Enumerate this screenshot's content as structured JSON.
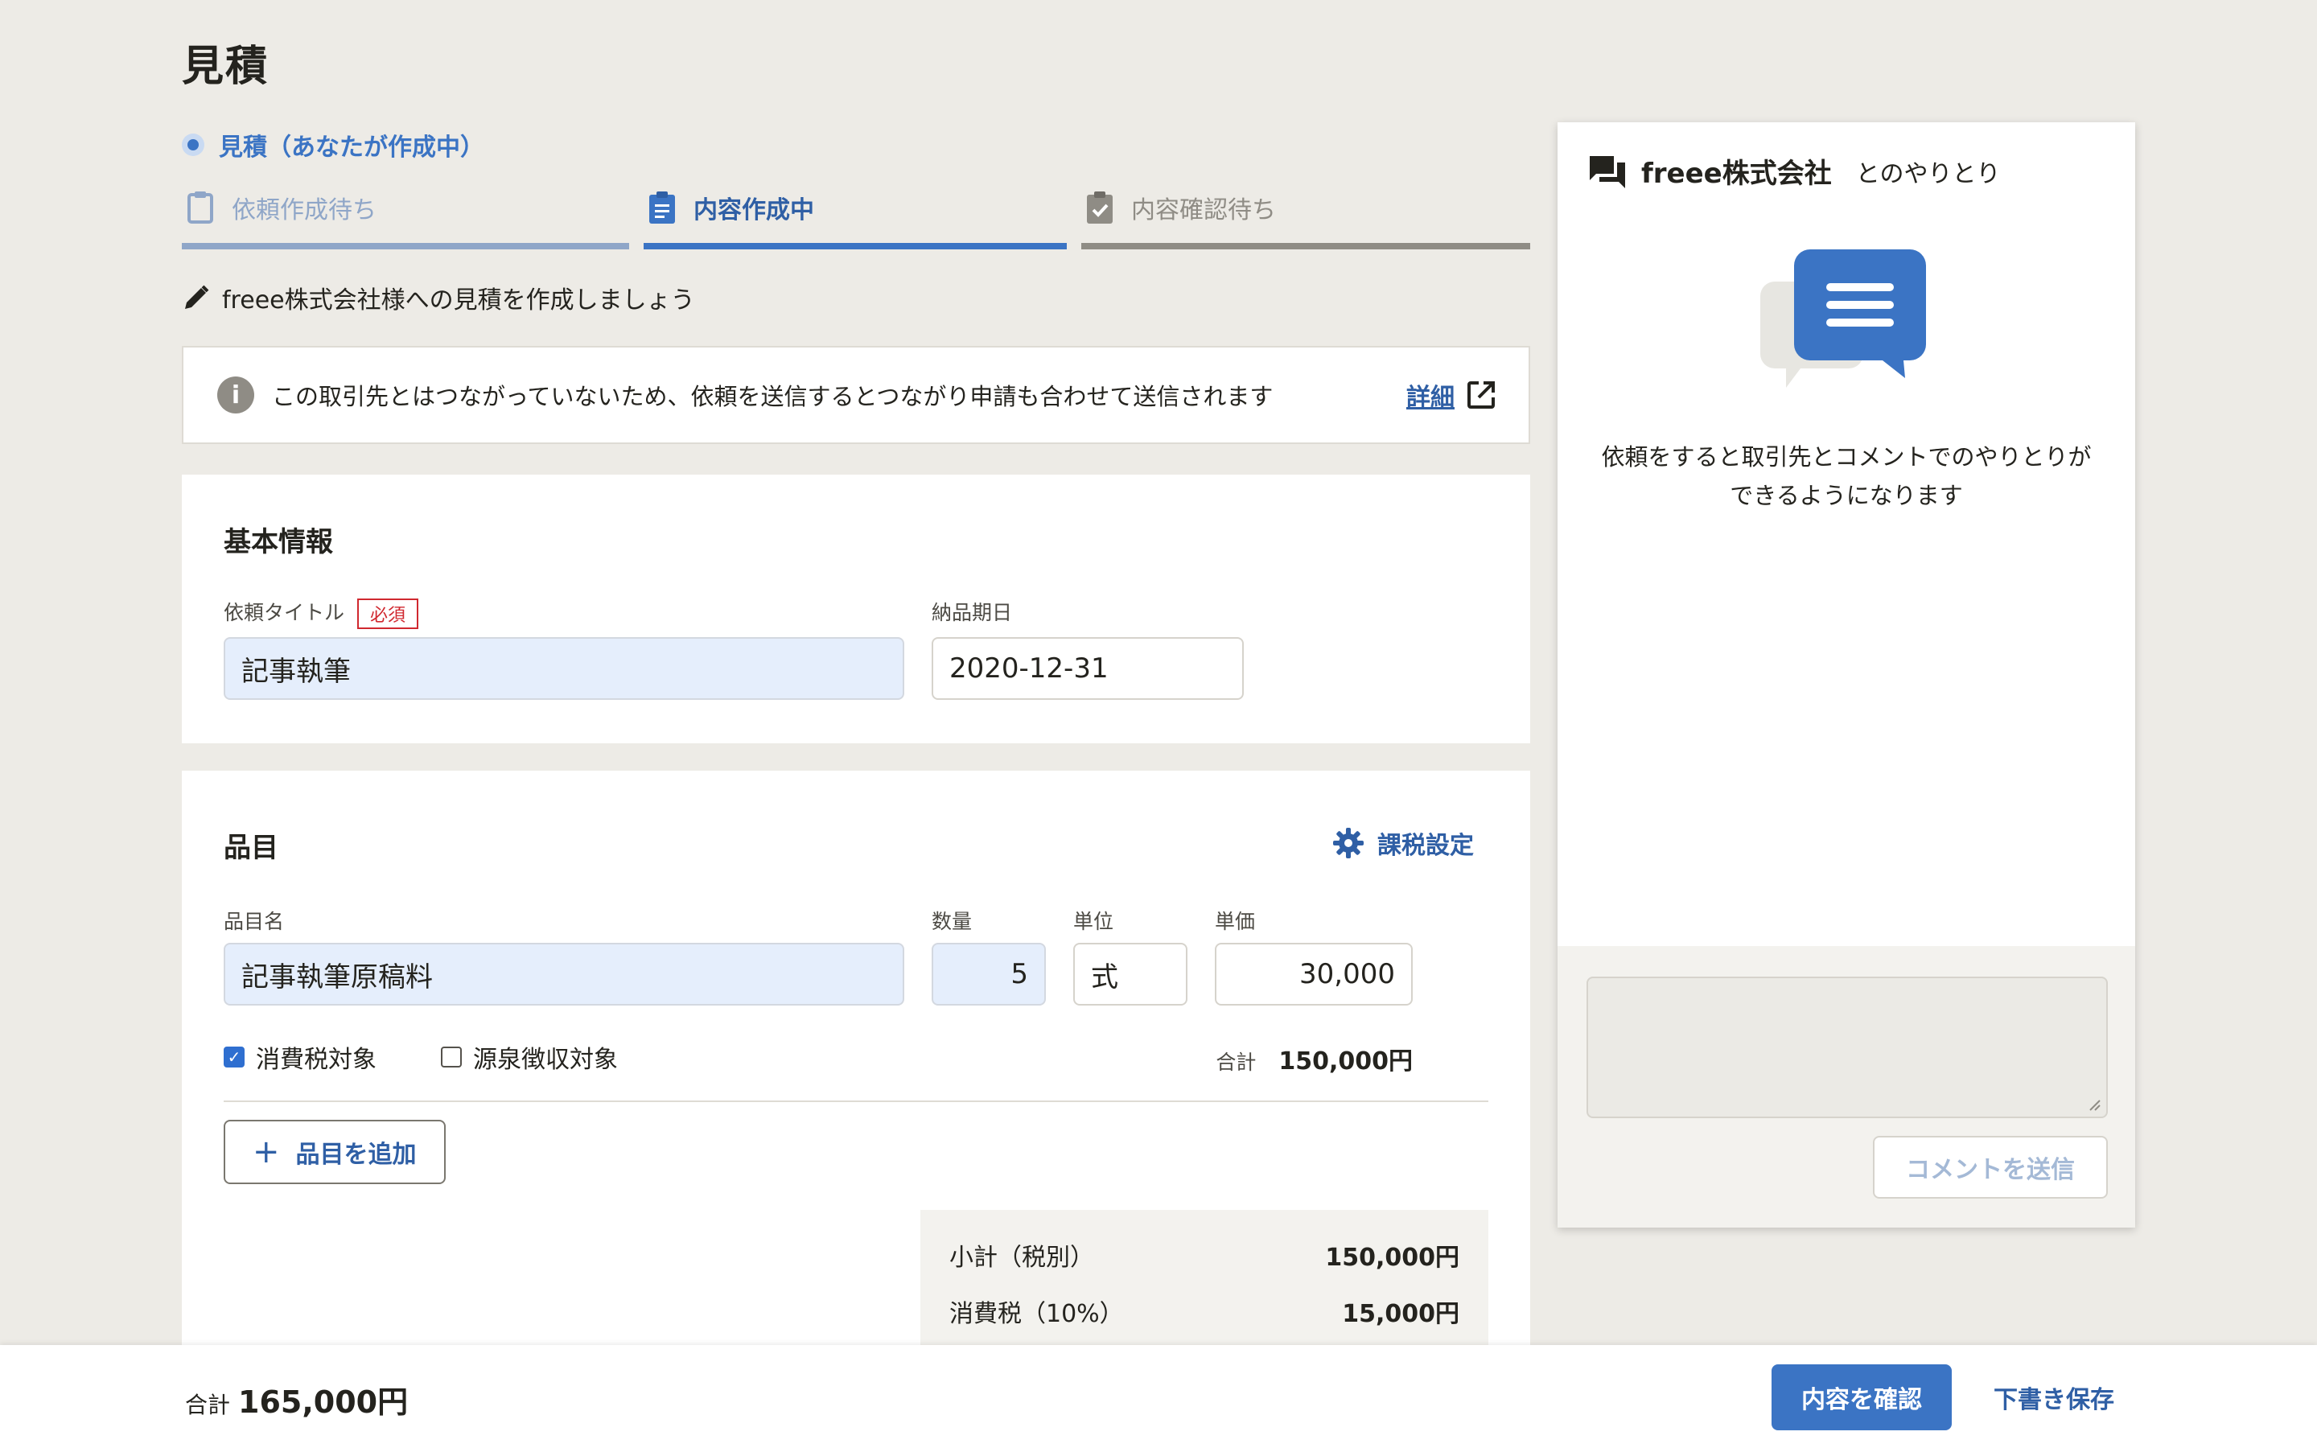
{
  "page": {
    "title": "見積"
  },
  "status": {
    "label": "見積（あなたが作成中）"
  },
  "steps": [
    {
      "label": "依頼作成待ち",
      "icon": "clipboard-icon"
    },
    {
      "label": "内容作成中",
      "icon": "clipboard-list-icon"
    },
    {
      "label": "内容確認待ち",
      "icon": "clipboard-check-icon"
    }
  ],
  "guide": {
    "text": "freee株式会社様への見積を作成しましょう",
    "icon": "pencil-icon"
  },
  "notice": {
    "icon_text": "i",
    "text": "この取引先とはつながっていないため、依頼を送信するとつながり申請も合わせて送信されます",
    "link": "詳細",
    "link_icon": "external-link-icon"
  },
  "basic": {
    "section_title": "基本情報",
    "title_label": "依頼タイトル",
    "required_badge": "必須",
    "title_value": "記事執筆",
    "due_label": "納品期日",
    "due_value": "2020-12-31"
  },
  "items": {
    "section_title": "品目",
    "tax_settings": "課税設定",
    "col_name": "品目名",
    "col_qty": "数量",
    "col_unit": "単位",
    "col_price": "単価",
    "rows": [
      {
        "name": "記事執筆原稿料",
        "qty": "5",
        "unit": "式",
        "price": "30,000",
        "consumption_tax_label": "消費税対象",
        "consumption_tax_checked": true,
        "withholding_label": "源泉徴収対象",
        "withholding_checked": false,
        "sum_label": "合計",
        "sum_value": "150,000円"
      }
    ],
    "add_label": "品目を追加"
  },
  "totals": {
    "subtotal_label": "小計（税別）",
    "subtotal_value": "150,000円",
    "tax_label": "消費税（10%）",
    "tax_value": "15,000円"
  },
  "side": {
    "company": "freee株式会社",
    "suffix": "とのやりとり",
    "message_line1": "依頼をすると取引先とコメントでのやりとりが",
    "message_line2": "できるようになります",
    "send_label": "コメントを送信"
  },
  "footer": {
    "total_label": "合計",
    "total_value": "165,000円",
    "confirm_label": "内容を確認",
    "draft_label": "下書き保存"
  },
  "colors": {
    "accent": "#3b74c4",
    "accent_dark": "#2f5fa5",
    "required": "#d0282f",
    "input_filled": "#e5eefc",
    "background": "#edebe6"
  }
}
